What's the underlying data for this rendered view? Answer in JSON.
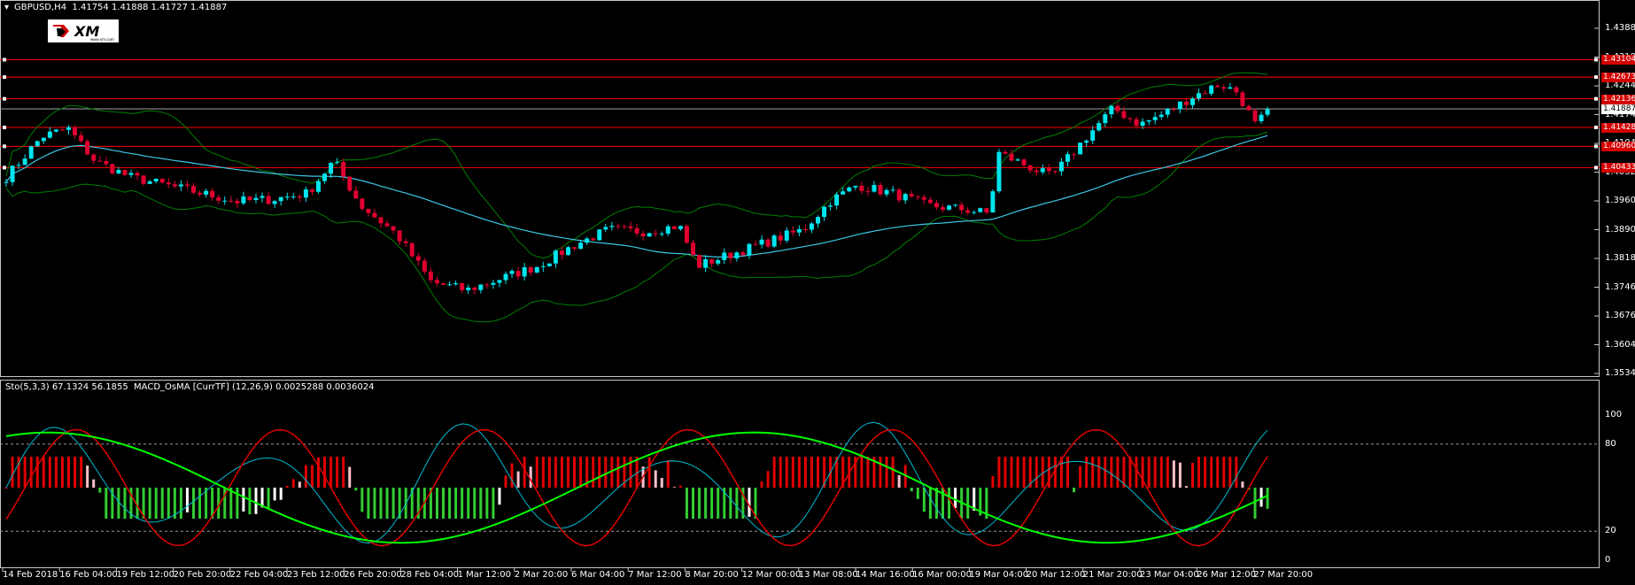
{
  "chart_header": {
    "title": "GBPUSD,H4  1.41754 1.41888 1.41727 1.41887",
    "collapse_icon": "triangle-down-icon"
  },
  "logo": {
    "text": "XM",
    "icon": "xm-logo-icon",
    "tagline": "www.xm.com"
  },
  "indicator_header": "Sto(5,3,3) 67.1324 56.1855  MACD_OsMA [CurrTF] (12,26,9) 0.0025288 0.0036024",
  "price_axis": [
    "1.43880",
    "1.43180",
    "1.42440",
    "1.41740",
    "1.41040",
    "1.40320",
    "1.39600",
    "1.38900",
    "1.38180",
    "1.37460",
    "1.36760",
    "1.36040",
    "1.35340"
  ],
  "price_range": [
    1.3534,
    1.4388
  ],
  "indicator_axis": [
    "100",
    "80",
    "20",
    "0"
  ],
  "levels": [
    {
      "value": 1.43104,
      "label": "1.43104"
    },
    {
      "value": 1.42673,
      "label": "1.42673"
    },
    {
      "value": 1.42136,
      "label": "1.42136"
    },
    {
      "value": 1.41428,
      "label": "1.41428"
    },
    {
      "value": 1.4096,
      "label": "1.40960"
    },
    {
      "value": 1.40433,
      "label": "1.40433"
    }
  ],
  "current_price": {
    "value": 1.41887,
    "label": "1.41887"
  },
  "time_axis": [
    "14 Feb 2018",
    "16 Feb 04:00",
    "19 Feb 12:00",
    "20 Feb 20:00",
    "22 Feb 04:00",
    "23 Feb 12:00",
    "26 Feb 20:00",
    "28 Feb 04:00",
    "1 Mar 12:00",
    "2 Mar 20:00",
    "6 Mar 04:00",
    "7 Mar 12:00",
    "8 Mar 20:00",
    "12 Mar 00:00",
    "13 Mar 08:00",
    "14 Mar 16:00",
    "16 Mar 00:00",
    "19 Mar 04:00",
    "20 Mar 12:00",
    "21 Mar 20:00",
    "23 Mar 04:00",
    "26 Mar 12:00",
    "27 Mar 20:00"
  ],
  "colors": {
    "bull": "#00e5ee",
    "bear": "#e00030",
    "level_line": "#ff0000",
    "ma": "#3cc8e6",
    "bands": "#008000",
    "stoch_main": "#00bcd4",
    "stoch_signal": "#e00000",
    "osma_signal": "#00ff00",
    "hist_up_rising": "#e00000",
    "hist_up_falling": "#ffc0cb",
    "hist_down_falling": "#32cd32",
    "hist_down_rising": "#ffffff",
    "grid": "#c8c8c8"
  }
}
